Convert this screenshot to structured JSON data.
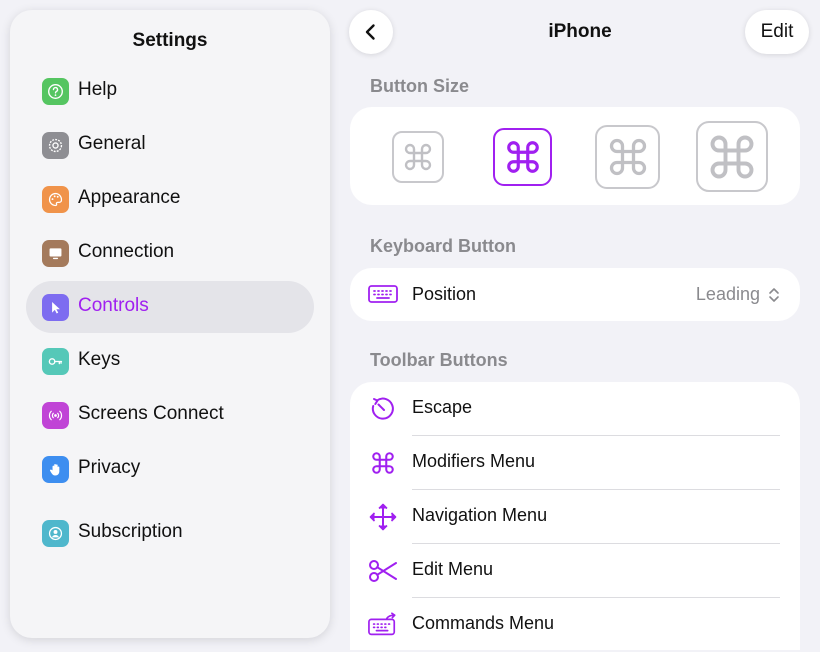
{
  "sidebar": {
    "title": "Settings",
    "items": [
      {
        "label": "Help",
        "icon": "help-icon",
        "color": "#55c561"
      },
      {
        "label": "General",
        "icon": "gear-icon",
        "color": "#8e8e93"
      },
      {
        "label": "Appearance",
        "icon": "palette-icon",
        "color": "#f0934a"
      },
      {
        "label": "Connection",
        "icon": "monitor-icon",
        "color": "#a47a5c"
      },
      {
        "label": "Controls",
        "icon": "cursor-icon",
        "color": "#7d6cf0",
        "selected": true
      },
      {
        "label": "Keys",
        "icon": "key-icon",
        "color": "#55c8b8"
      },
      {
        "label": "Screens Connect",
        "icon": "broadcast-icon",
        "color": "#c044d6"
      },
      {
        "label": "Privacy",
        "icon": "hand-icon",
        "color": "#3d8ef0"
      },
      {
        "label": "Subscription",
        "icon": "person-circle-icon",
        "color": "#4fb7cc"
      }
    ]
  },
  "detail": {
    "title": "iPhone",
    "edit_label": "Edit",
    "accent": "#a020f0"
  },
  "button_size": {
    "header": "Button Size",
    "selected_index": 1
  },
  "keyboard_button": {
    "header": "Keyboard Button",
    "position_label": "Position",
    "position_value": "Leading"
  },
  "toolbar_buttons": {
    "header": "Toolbar Buttons",
    "items": [
      {
        "label": "Escape",
        "icon": "escape-icon"
      },
      {
        "label": "Modifiers Menu",
        "icon": "command-icon"
      },
      {
        "label": "Navigation Menu",
        "icon": "move-arrows-icon"
      },
      {
        "label": "Edit Menu",
        "icon": "scissors-icon"
      },
      {
        "label": "Commands Menu",
        "icon": "keyboard-arrow-icon"
      }
    ]
  }
}
